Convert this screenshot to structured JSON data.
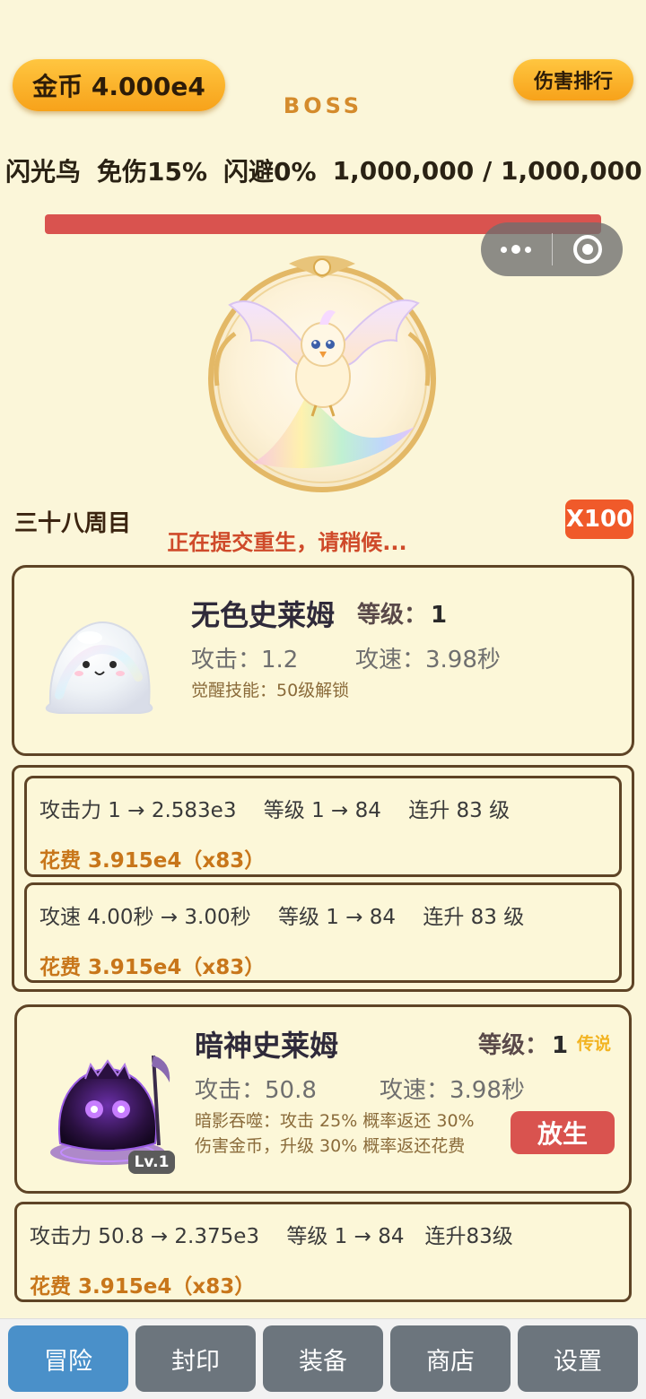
{
  "header": {
    "gold_label": "金币 4.000e4",
    "rank_label": "伤害排行",
    "boss_label": "BOSS"
  },
  "boss": {
    "name": "闪光鸟",
    "damage_reduction": "免伤15%",
    "dodge": "闪避0%",
    "hp_text": "1,000,000 / 1,000,000",
    "hp_fraction": 1.0,
    "hp_color": "#d9534f"
  },
  "capsule": {
    "more_icon": "more-dots-icon",
    "close_icon": "target-icon"
  },
  "cycle_label": "三十八周目",
  "reborn_message": "正在提交重生，请稍候...",
  "multiplier_label": "X100",
  "pets": [
    {
      "name": "无色史莱姆",
      "level_label": "等级：",
      "level": "1",
      "attack": "攻击：1.2",
      "speed": "攻速：3.98秒",
      "skill": "觉醒技能：50级解锁",
      "icon": "clear-slime-icon"
    },
    {
      "name": "暗神史莱姆",
      "level_label": "等级：",
      "level": "1",
      "rarity": "传说",
      "attack": "攻击：50.8",
      "speed": "攻速：3.98秒",
      "skill_line1": "暗影吞噬：攻击 25% 概率返还 30%",
      "skill_line2": "伤害金币，升级 30% 概率返还花费",
      "release_label": "放生",
      "badge": "Lv.1",
      "icon": "dark-slime-icon"
    }
  ],
  "upgrades": [
    {
      "text": "攻击力 1 → 2.583e3　 等级 1 → 84　 连升 83 级",
      "cost": "花费  3.915e4（x83）"
    },
    {
      "text": "攻速 4.00秒 → 3.00秒　 等级 1 → 84　 连升 83 级",
      "cost": "花费  3.915e4（x83）"
    },
    {
      "text": "攻击力 50.8 → 2.375e3　 等级 1 → 84　连升83级",
      "cost": "花费  3.915e4（x83）"
    }
  ],
  "nav": {
    "tabs": [
      "冒险",
      "封印",
      "装备",
      "商店",
      "设置"
    ],
    "active": 0,
    "active_color": "#4a90c9",
    "inactive_color": "#6c757d"
  }
}
